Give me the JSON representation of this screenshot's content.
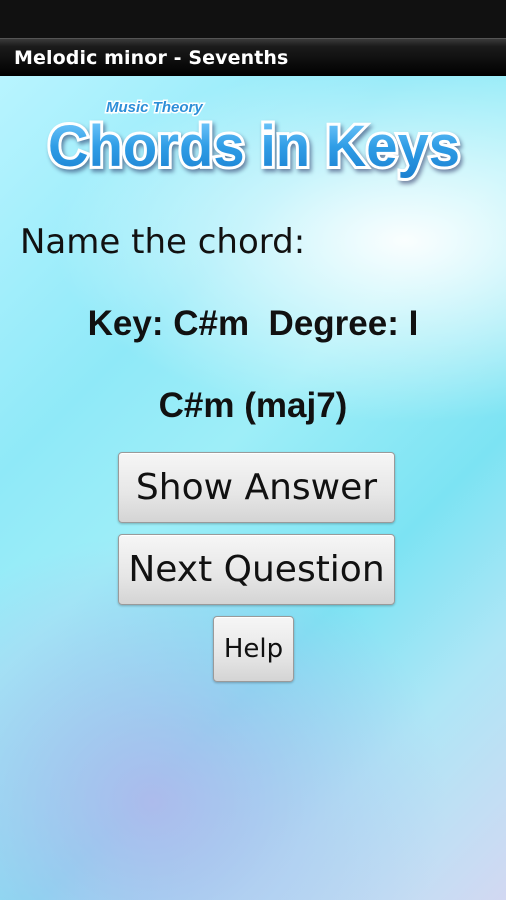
{
  "window": {
    "title": "Melodic minor - Sevenths"
  },
  "logo": {
    "small_text": "Music Theory",
    "main_text": "Chords in Keys"
  },
  "quiz": {
    "prompt": "Name the chord:",
    "key_degree": "Key: C#m  Degree: I",
    "chord": "C#m (maj7)"
  },
  "buttons": {
    "show_answer": "Show Answer",
    "next_question": "Next Question",
    "help": "Help"
  },
  "colors": {
    "logo_text": "#3da3e4",
    "logo_outline": "#ffffff",
    "title_bar": "#000000"
  }
}
